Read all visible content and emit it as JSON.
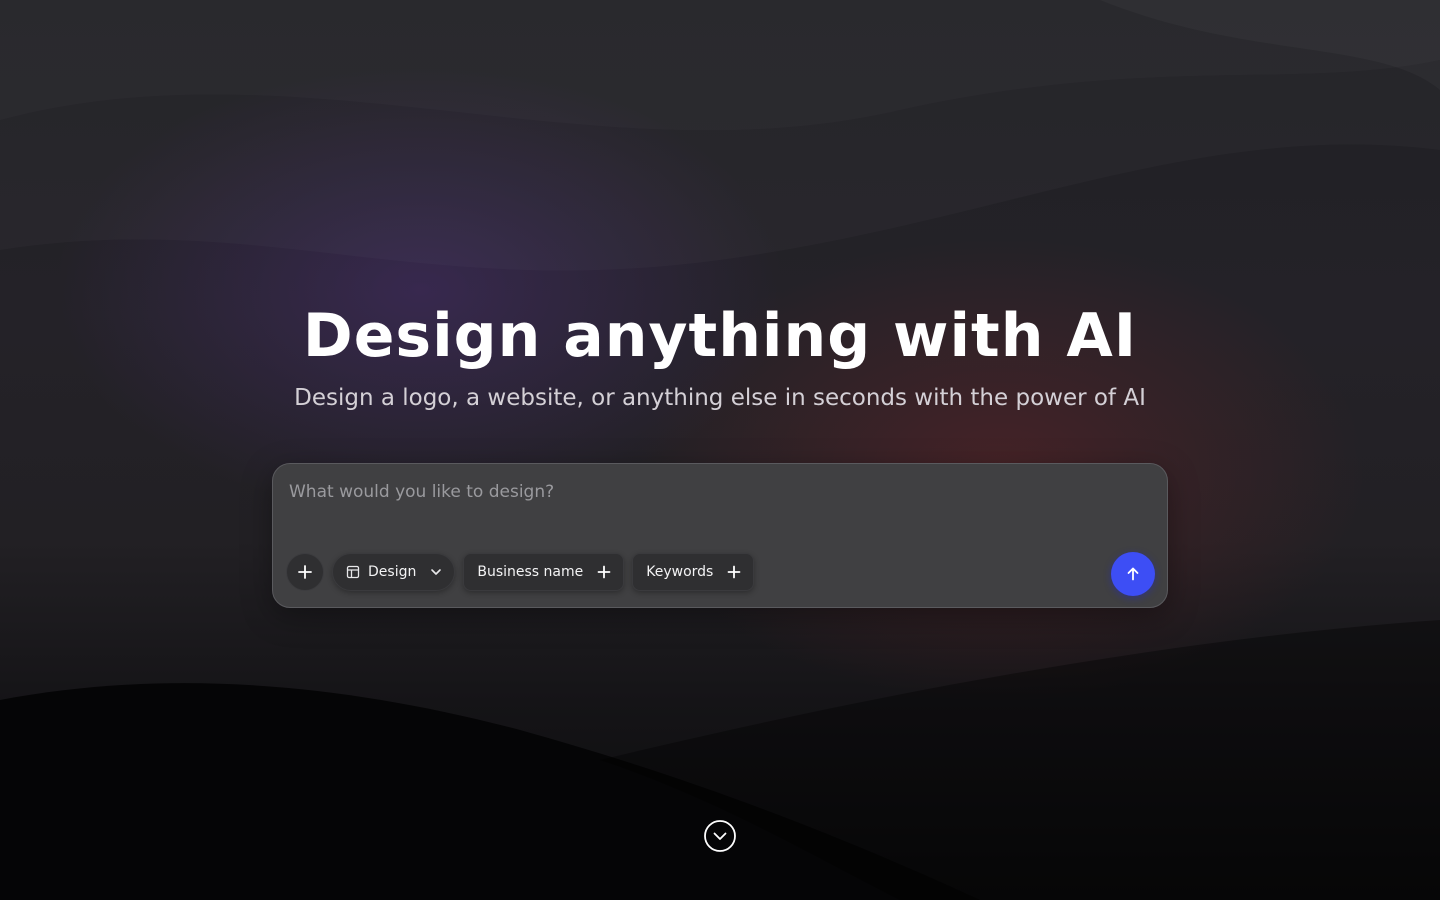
{
  "hero": {
    "title": "Design anything with AI",
    "subtitle": "Design a logo, a website, or anything else in seconds with the power of AI"
  },
  "prompt": {
    "placeholder": "What would you like to design?",
    "value": ""
  },
  "toolbar": {
    "add_icon": "plus-icon",
    "design_chip": {
      "label": "Design",
      "icon": "layout-icon",
      "trailing_icon": "chevron-down-icon"
    },
    "business_name_chip": {
      "label": "Business name",
      "trailing_icon": "plus-icon"
    },
    "keywords_chip": {
      "label": "Keywords",
      "trailing_icon": "plus-icon"
    },
    "send_icon": "arrow-up-icon"
  },
  "scroll": {
    "icon": "chevron-down-circle-icon"
  },
  "colors": {
    "accent": "#3d4ef5",
    "prompt_bg": "#404042",
    "chip_bg": "#2f2f31",
    "title": "#ffffff",
    "subtitle": "#d4d0d6"
  }
}
